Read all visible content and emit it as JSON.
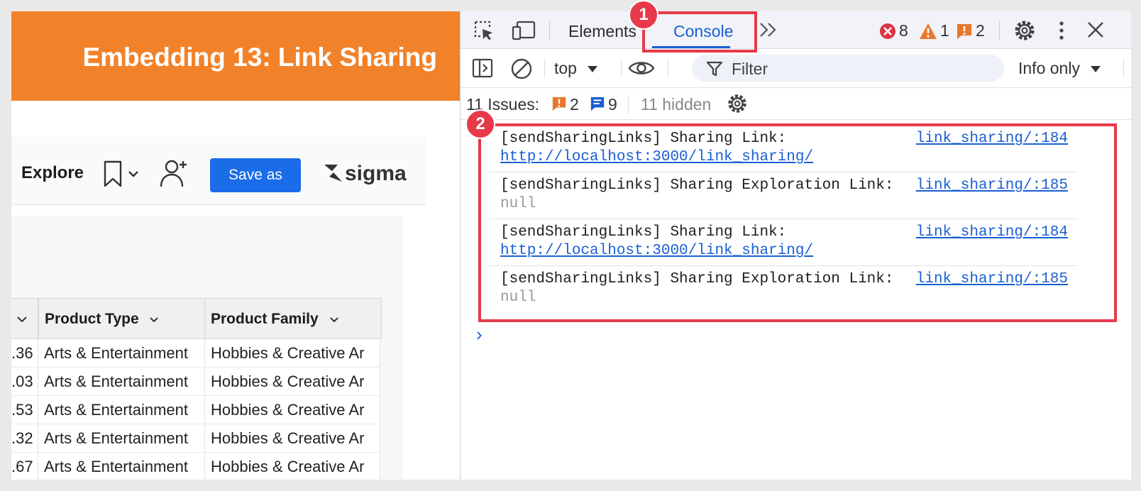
{
  "app": {
    "banner_title": "Embedding 13: Link Sharing",
    "explore_label": "Explore",
    "save_as_label": "Save as",
    "logo_text": "sigma",
    "table": {
      "columns": [
        "Product Type",
        "Product Family"
      ],
      "rows": [
        {
          "prefix": ".36",
          "product_type": "Arts & Entertainment",
          "product_family": "Hobbies & Creative Ar"
        },
        {
          "prefix": ".03",
          "product_type": "Arts & Entertainment",
          "product_family": "Hobbies & Creative Ar"
        },
        {
          "prefix": ".53",
          "product_type": "Arts & Entertainment",
          "product_family": "Hobbies & Creative Ar"
        },
        {
          "prefix": ".32",
          "product_type": "Arts & Entertainment",
          "product_family": "Hobbies & Creative Ar"
        },
        {
          "prefix": ".67",
          "product_type": "Arts & Entertainment",
          "product_family": "Hobbies & Creative Ar"
        }
      ]
    }
  },
  "devtools": {
    "tabs": {
      "elements": "Elements",
      "console": "Console"
    },
    "counts": {
      "errors": "8",
      "warnings": "1",
      "issues": "2"
    },
    "toolbar": {
      "context": "top",
      "filter_placeholder": "Filter",
      "level": "Info only"
    },
    "issues_bar": {
      "label": "11 Issues:",
      "issue_count": "2",
      "info_count": "9",
      "hidden": "11 hidden"
    },
    "messages": [
      {
        "text": "[sendSharingLinks] Sharing Link:",
        "source": "link_sharing/:184",
        "value": "http://localhost:3000/link_sharing/",
        "value_type": "link"
      },
      {
        "text": "[sendSharingLinks] Sharing Exploration Link:",
        "source": "link_sharing/:185",
        "value": "null",
        "value_type": "null"
      },
      {
        "text": "[sendSharingLinks] Sharing Link:",
        "source": "link_sharing/:184",
        "value": "http://localhost:3000/link_sharing/",
        "value_type": "link"
      },
      {
        "text": "[sendSharingLinks] Sharing Exploration Link:",
        "source": "link_sharing/:185",
        "value": "null",
        "value_type": "null"
      }
    ],
    "prompt_glyph": "›"
  },
  "annotations": {
    "badge_1": "1",
    "badge_2": "2"
  },
  "colors": {
    "banner": "#f2822a",
    "highlight": "#e8394a",
    "link": "#1a5fd3",
    "save_button": "#1a6ce8"
  }
}
